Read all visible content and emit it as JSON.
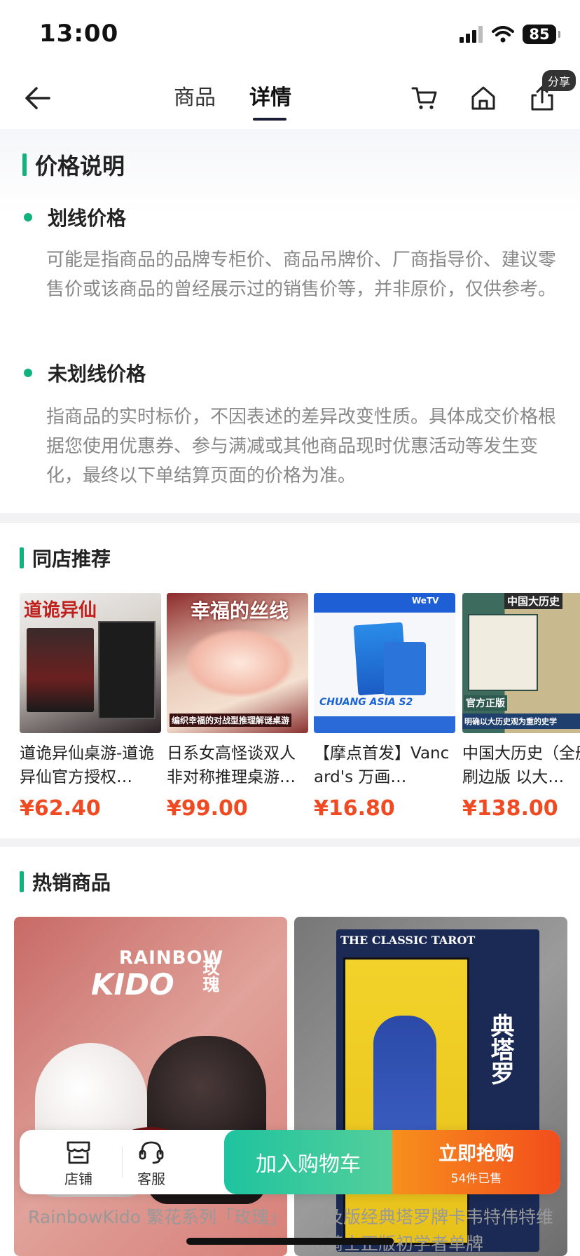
{
  "status_bar": {
    "time": "13:00",
    "battery": "85"
  },
  "nav": {
    "tabs": [
      {
        "label": "商品"
      },
      {
        "label": "详情"
      }
    ],
    "share_badge": "分享"
  },
  "price_section": {
    "title": "价格说明",
    "items": [
      {
        "heading": "划线价格",
        "text": "可能是指商品的品牌专柜价、商品吊牌价、厂商指导价、建议零售价或该商品的曾经展示过的销售价等，并非原价，仅供参考。"
      },
      {
        "heading": "未划线价格",
        "text": "指商品的实时标价，不因表述的差异改变性质。具体成交价格根据您使用优惠券、参与满减或其他商品现时优惠活动等发生变化，最终以下单结算页面的价格为准。"
      }
    ]
  },
  "recommend": {
    "title": "同店推荐",
    "items": [
      {
        "name": "道诡异仙桌游-道诡异仙官方授权…",
        "price": "¥62.40",
        "image_text": "道诡异仙"
      },
      {
        "name": "日系女高怪谈双人非对称推理桌游…",
        "price": "¥99.00",
        "image_text": "幸福的丝线",
        "image_subtext": "编织幸福的对战型推理解谜桌游"
      },
      {
        "name": "【摩点首发】Vancard's 万画…",
        "price": "¥16.80",
        "image_text": "CHUANG ASIA S2",
        "image_subtext": "WeTV"
      },
      {
        "name": "中国大历史（全册）刷边版 以大…",
        "price": "¥138.00",
        "image_text": "中国大历史",
        "image_subtext": "官方正版",
        "image_subtext2": "明确以大历史观为重的史学"
      }
    ]
  },
  "hot": {
    "title": "热销商品",
    "items": [
      {
        "name": "RainbowKido 繁花系列「玫瑰」",
        "image_text": "RAINBOW",
        "image_text2": "KIDO",
        "image_text3": "玫瑰"
      },
      {
        "name": "普及版经典塔罗牌卡韦特伟特维特骑士正版初学者单牌",
        "image_text": "THE CLASSIC TAROT",
        "image_text2": "典塔罗"
      }
    ]
  },
  "bottom_bar": {
    "shop_label": "店铺",
    "service_label": "客服",
    "add_cart_label": "加入购物车",
    "buy_label": "立即抢购",
    "sold_label": "54件已售"
  },
  "colors": {
    "accent_green": "#12b27f",
    "price_red": "#f04a22",
    "buy_orange": "#f24d1c"
  },
  "icons": [
    "back-icon",
    "cart-icon",
    "home-icon",
    "share-icon",
    "shop-icon",
    "headset-icon",
    "signal-icon",
    "wifi-icon"
  ]
}
